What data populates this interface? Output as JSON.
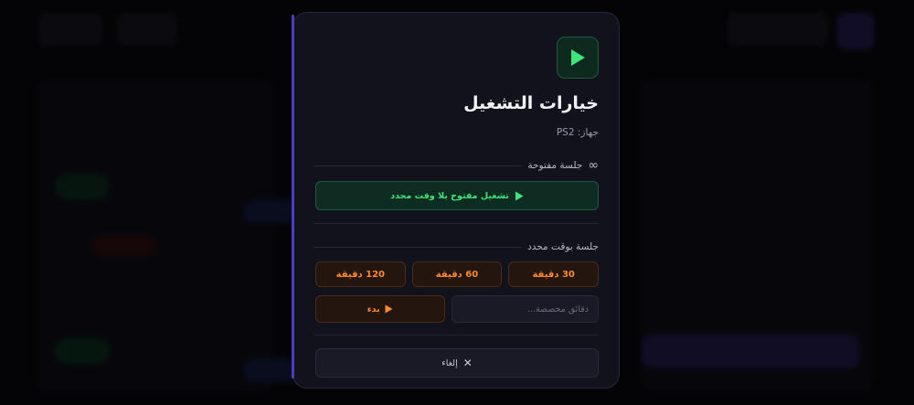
{
  "modal": {
    "title": "خيارات التشغيل",
    "device": "جهاز: PS2",
    "open_section": {
      "label": "جلسة مفتوحة",
      "icon": "infinity-icon",
      "button_label": "تشغيل مفتوح بلا وقت محدد"
    },
    "timed_section": {
      "label": "جلسة بوقت محدد",
      "durations": [
        "30 دقيقة",
        "60 دقيقة",
        "120 دقيقة"
      ],
      "custom_placeholder": "دقائق مخصصة...",
      "start_label": "بدء"
    },
    "cancel_label": "إلغاء"
  },
  "colors": {
    "accent_green": "#3ee57a",
    "accent_orange": "#ff8a2a",
    "accent_purple": "#4b3cc0",
    "modal_bg": "#12121c"
  }
}
